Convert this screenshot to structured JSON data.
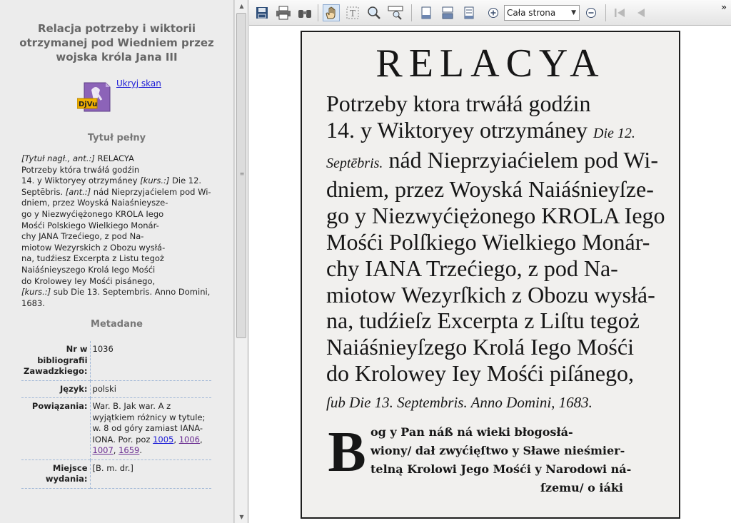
{
  "record": {
    "title": "Relacja potrzeby i wiktorii otrzymanej pod Wiedniem przez wojska króla Jana III",
    "hide_scan_link": "Ukryj skan",
    "djvu_label": "DjVu"
  },
  "full_title": {
    "heading": "Tytuł pełny",
    "lines": [
      [
        "[Tytuł nagł., ant.:]",
        " RELACYA"
      ],
      [
        "",
        "Potrzeby która trwáłá godźin"
      ],
      [
        "",
        "14. y Wiktoryey otrzymáney ",
        "[kurs.:]",
        " Die 12."
      ],
      [
        "",
        "Septēbris. ",
        "[ant.:]",
        " nád Nieprzyjaćielem pod Wi-"
      ],
      [
        "",
        "dniem, przez Woyská Naiaśnieysze-"
      ],
      [
        "",
        "go y Niezwyćiężonego KROLA Iego"
      ],
      [
        "",
        "Mośći Polskiego Wielkiego Monár-"
      ],
      [
        "",
        "chy JANA Trzećiego, z pod Na-"
      ],
      [
        "",
        "miotow Wezyrskich z Obozu wysłá-"
      ],
      [
        "",
        "na, tudźiesz Excerpta z Listu tegoż"
      ],
      [
        "",
        "Naiáśnieyszego Krolá Iego Mośći"
      ],
      [
        "",
        "do Krolowey Iey Mośći pisánego,"
      ],
      [
        "[kurs.:]",
        " sub Die 13. Septembris. Anno Domini,"
      ],
      [
        "",
        "1683."
      ]
    ]
  },
  "metadata": {
    "heading": "Metadane",
    "rows": [
      {
        "key": "Nr w bibliografii Zawadzkiego:",
        "value": "1036"
      },
      {
        "key": "Język:",
        "value": "polski"
      },
      {
        "key": "Powiązania:",
        "value": "War. B. Jak war. A z wyjątkiem różnicy w tytule; w. 8 od góry zamiast IANA-IONA. Por. poz ",
        "links": [
          "1005",
          "1006",
          "1007",
          "1659"
        ]
      },
      {
        "key": "Miejsce wydania:",
        "value": "[B. m. dr.]"
      }
    ]
  },
  "toolbar": {
    "zoom_value": "Cała strona",
    "icons": [
      "save-icon",
      "print-icon",
      "find-icon",
      "hand-tool-icon",
      "text-select-icon",
      "zoom-tool-icon",
      "magnifier-icon",
      "single-page-icon",
      "continuous-page-icon",
      "facing-page-icon",
      "zoom-in-icon",
      "zoom-out-icon",
      "first-page-icon",
      "previous-page-icon"
    ],
    "overflow": "»"
  },
  "scan": {
    "heading": "RELACYA",
    "lines": [
      [
        "Potrzeby ktora trwáłá godźin"
      ],
      [
        "14. y Wiktoryey otrzymáney ",
        "Die 12."
      ],
      [
        "Septēbris.",
        " nád Nieprzyiaćielem pod Wi-"
      ],
      [
        "dniem, przez Woyská Naiáśnieyſze-"
      ],
      [
        "go y Niezwyćiężonego KROLA Iego"
      ],
      [
        "Mośći Polſkiego Wielkiego Monár-"
      ],
      [
        "chy IANA Trzećiego, z pod Na-"
      ],
      [
        "miotow Wezyrſkich z Obozu wysłá-"
      ],
      [
        "na, tudźieſz Excerpta z Liſtu tegoż"
      ],
      [
        "Naiáśnieyſzego Krolá Iego Mośći"
      ],
      [
        "do Krolowey Iey Mośći piſánego,"
      ],
      [
        "ſub Die 13. Septembris.   Anno Domini, 1683."
      ]
    ],
    "initial": "B",
    "gothic": [
      "og y Pan náß ná wieki błogosłá-",
      "wiony/ dał zwyćięſtwo y Sławe nieśmier-",
      "telną Krolowi Jego Mośći y Narodowi ná-",
      "ſzemu/ o iáki"
    ]
  }
}
